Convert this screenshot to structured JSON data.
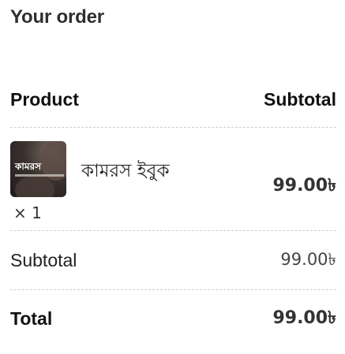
{
  "order": {
    "title": "Your order",
    "header": {
      "product": "Product",
      "subtotal": "Subtotal"
    },
    "item": {
      "thumbnail_text": "কামরস",
      "name": "কামরস ইবুক",
      "quantity": "× 1",
      "price": "99.00৳"
    },
    "subtotal": {
      "label": "Subtotal",
      "value": "99.00৳"
    },
    "total": {
      "label": "Total",
      "value": "99.00৳"
    }
  }
}
